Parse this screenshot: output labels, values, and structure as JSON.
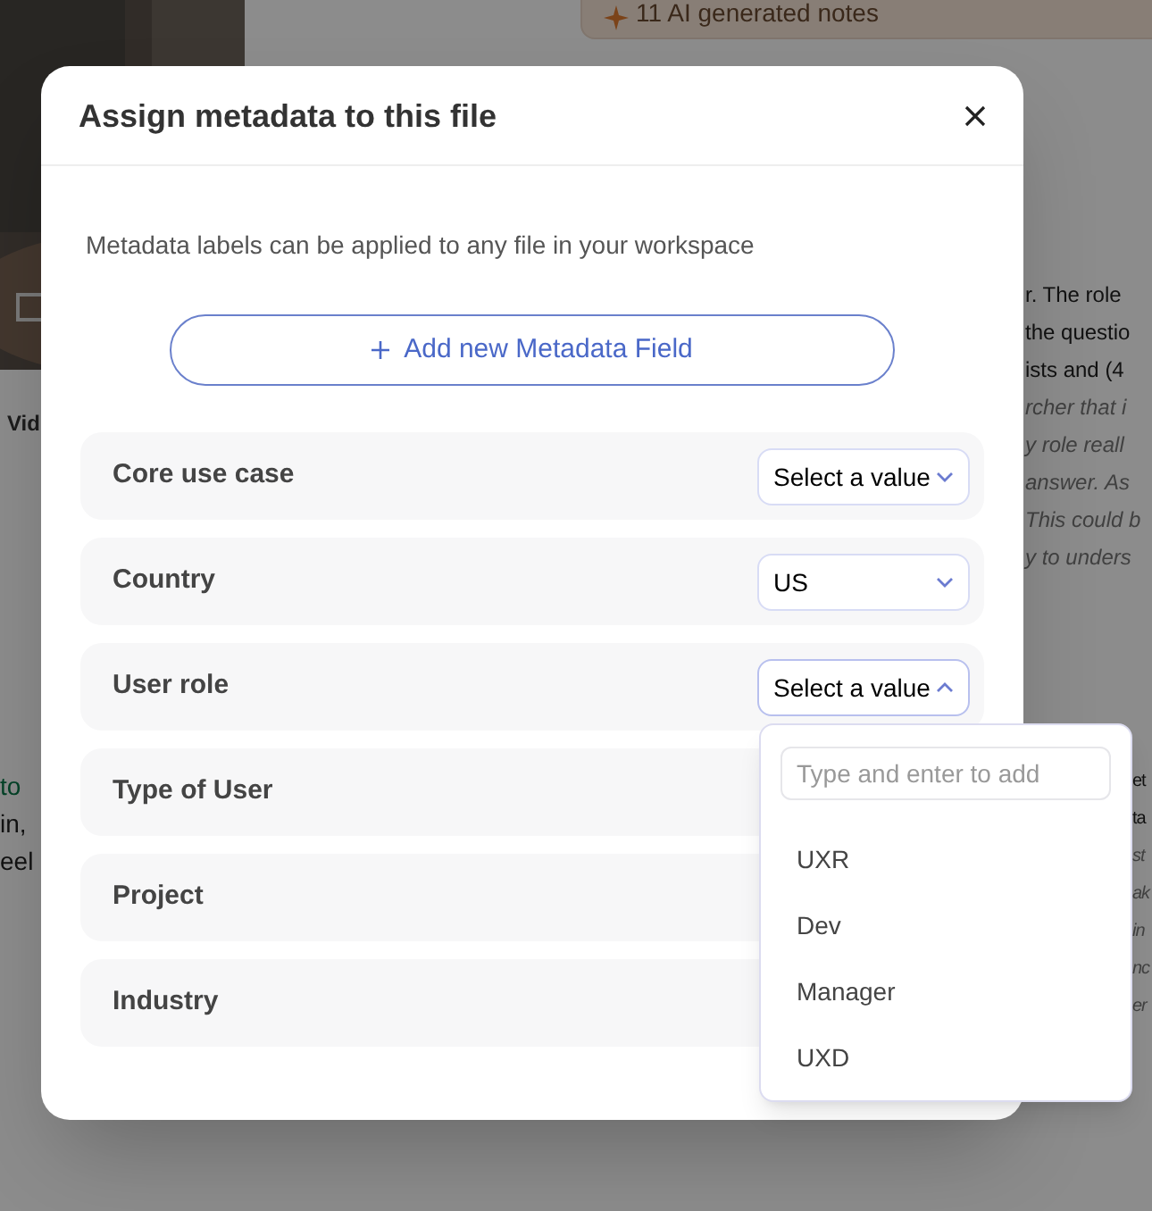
{
  "background": {
    "notes_chip": "11 AI generated notes",
    "video_label": "Vid",
    "left_lines": [
      {
        "text": "to",
        "kind": "link"
      },
      {
        "text": "in,",
        "kind": "plain"
      },
      {
        "text": "eel",
        "kind": "plain"
      }
    ],
    "right_lines": [
      {
        "text": "r. The role",
        "italic": false
      },
      {
        "text": "the questio",
        "italic": false
      },
      {
        "text": "ists and (4",
        "italic": false
      },
      {
        "text": "rcher that i",
        "italic": true
      },
      {
        "text": "y role reall",
        "italic": true
      },
      {
        "text": "answer. As",
        "italic": true
      },
      {
        "text": "This could b",
        "italic": true
      },
      {
        "text": "y to unders",
        "italic": true
      }
    ],
    "edge_lines": [
      {
        "text": "et",
        "italic": false
      },
      {
        "text": "ta",
        "italic": false
      },
      {
        "text": "st",
        "italic": true
      },
      {
        "text": "ak",
        "italic": true
      },
      {
        "text": "in",
        "italic": true
      },
      {
        "text": "nc",
        "italic": true
      },
      {
        "text": "er",
        "italic": true
      }
    ]
  },
  "dialog": {
    "title": "Assign metadata to this file",
    "description": "Metadata labels can be applied to any file in your workspace",
    "add_button": "Add new Metadata Field",
    "fields": [
      {
        "label": "Core use case",
        "value": "Select a value",
        "open": false
      },
      {
        "label": "Country",
        "value": "US",
        "open": false
      },
      {
        "label": "User role",
        "value": "Select a value",
        "open": true
      },
      {
        "label": "Type of User"
      },
      {
        "label": "Project"
      },
      {
        "label": "Industry"
      }
    ],
    "dropdown": {
      "placeholder": "Type and enter to add",
      "options": [
        "UXR",
        "Dev",
        "Manager",
        "UXD"
      ]
    }
  }
}
